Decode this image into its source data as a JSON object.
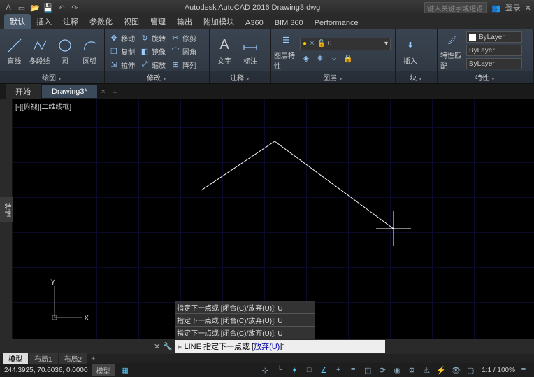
{
  "app": {
    "title": "Autodesk AutoCAD 2016   Drawing3.dwg",
    "search_placeholder": "键入关键字或短语",
    "login": "登录"
  },
  "ribbon": {
    "tabs": [
      "默认",
      "插入",
      "注释",
      "参数化",
      "视图",
      "管理",
      "输出",
      "附加模块",
      "A360",
      "BIM 360",
      "Performance"
    ],
    "active_tab": 0,
    "panels": {
      "draw": {
        "title": "绘图",
        "line": "直线",
        "polyline": "多段线",
        "circle": "圆",
        "arc": "圆弧"
      },
      "modify": {
        "title": "修改",
        "move": "移动",
        "rotate": "旋转",
        "trim": "修剪",
        "copy": "复制",
        "mirror": "镜像",
        "fillet": "圆角",
        "stretch": "拉伸",
        "scale": "缩放",
        "array": "阵列"
      },
      "annot": {
        "title": "注释",
        "text": "文字",
        "dim": "标注"
      },
      "layers": {
        "title": "图层",
        "props": "图层特性",
        "current": "0"
      },
      "block": {
        "title": "块",
        "insert": "插入"
      },
      "props": {
        "title": "特性",
        "match": "特性匹配",
        "color": "ByLayer",
        "ltype": "ByLayer",
        "lweight": "ByLayer"
      }
    }
  },
  "file_tabs": {
    "start": "开始",
    "drawing": "Drawing3*"
  },
  "viewport": {
    "label": "[-][俯视][二维线框]"
  },
  "ucs": {
    "x": "X",
    "y": "Y"
  },
  "prop_palette": "特性",
  "cmd": {
    "history": [
      "指定下一点或 [闭合(C)/放弃(U)]: U",
      "指定下一点或 [闭合(C)/放弃(U)]: U",
      "指定下一点或 [闭合(C)/放弃(U)]: U"
    ],
    "prompt_prefix": "LINE 指定下一点或 [",
    "prompt_option": "放弃(U)",
    "prompt_suffix": "]:"
  },
  "layout_tabs": {
    "model": "模型",
    "l1": "布局1",
    "l2": "布局2"
  },
  "status": {
    "coords": "244.3925, 70.6036, 0.0000",
    "mode": "模型",
    "scale": "1:1 / 100%"
  }
}
